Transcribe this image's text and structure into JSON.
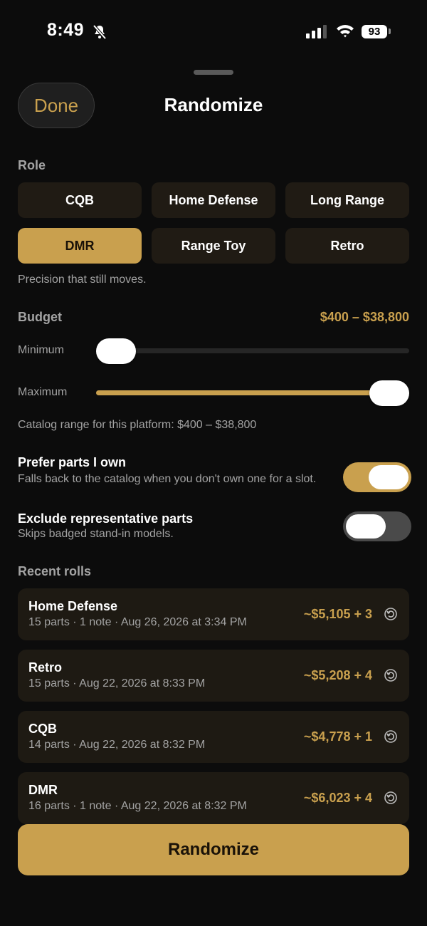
{
  "status": {
    "time": "8:49",
    "battery": "93"
  },
  "header": {
    "done_label": "Done",
    "title": "Randomize"
  },
  "role": {
    "label": "Role",
    "options": [
      "CQB",
      "Home Defense",
      "Long Range",
      "DMR",
      "Range Toy",
      "Retro"
    ],
    "selected": "DMR",
    "description": "Precision that still moves."
  },
  "budget": {
    "label": "Budget",
    "range_text": "$400 – $38,800",
    "minimum_label": "Minimum",
    "maximum_label": "Maximum",
    "min_fraction": 0.0,
    "max_fraction": 1.0,
    "catalog_note": "Catalog range for this platform: $400 – $38,800"
  },
  "toggles": {
    "prefer_owned": {
      "title": "Prefer parts I own",
      "subtitle": "Falls back to the catalog when you don't own one for a slot.",
      "on": true
    },
    "exclude_representative": {
      "title": "Exclude representative parts",
      "subtitle": "Skips badged stand-in models.",
      "on": false
    }
  },
  "recent": {
    "label": "Recent rolls",
    "items": [
      {
        "title": "Home Defense",
        "subtitle": "15 parts · 1 note · Aug 26, 2026 at 3:34 PM",
        "price": "~$5,105 + 3"
      },
      {
        "title": "Retro",
        "subtitle": "15 parts · Aug 22, 2026 at 8:33 PM",
        "price": "~$5,208 + 4"
      },
      {
        "title": "CQB",
        "subtitle": "14 parts · Aug 22, 2026 at 8:32 PM",
        "price": "~$4,778 + 1"
      },
      {
        "title": "DMR",
        "subtitle": "16 parts · 1 note · Aug 22, 2026 at 8:32 PM",
        "price": "~$6,023 + 4"
      }
    ]
  },
  "footer": {
    "randomize_label": "Randomize"
  },
  "colors": {
    "accent": "#c9a04e",
    "background": "#0c0c0c",
    "card": "#1e1a13"
  }
}
